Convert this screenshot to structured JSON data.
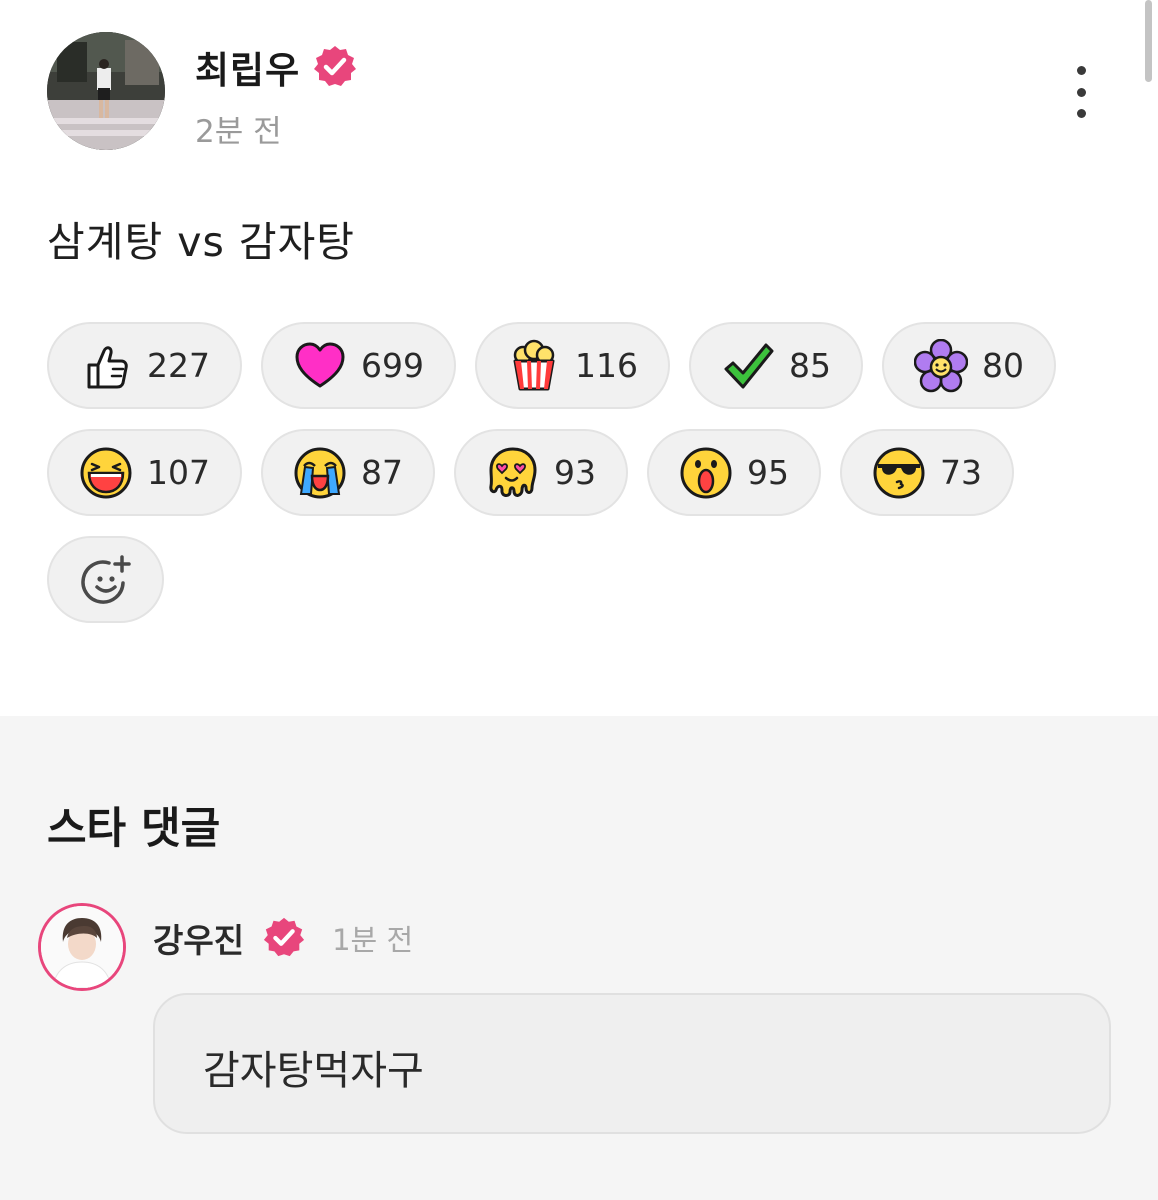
{
  "post": {
    "author": "최립우",
    "time": "2분 전",
    "text": "삼계탕 vs 감자탕",
    "verified_icon": "verified-badge-icon",
    "more_icon": "more-vertical-icon"
  },
  "reactions": [
    {
      "icon": "thumbs-up-icon",
      "count": "227"
    },
    {
      "icon": "heart-icon",
      "count": "699"
    },
    {
      "icon": "popcorn-icon",
      "count": "116"
    },
    {
      "icon": "checkmark-icon",
      "count": "85"
    },
    {
      "icon": "flower-icon",
      "count": "80"
    },
    {
      "icon": "laughing-face-icon",
      "count": "107"
    },
    {
      "icon": "crying-face-icon",
      "count": "87"
    },
    {
      "icon": "melting-heart-eyes-icon",
      "count": "93"
    },
    {
      "icon": "surprised-face-icon",
      "count": "95"
    },
    {
      "icon": "sunglasses-kiss-icon",
      "count": "73"
    }
  ],
  "add_reaction_icon": "add-emoji-icon",
  "star_comments": {
    "title": "스타 댓글",
    "comment": {
      "author": "강우진",
      "time": "1분 전",
      "text": "감자탕먹자구"
    }
  },
  "colors": {
    "badge": "#e8467c",
    "chip_bg": "#f1f1f1",
    "section_bg": "#f5f5f5"
  }
}
